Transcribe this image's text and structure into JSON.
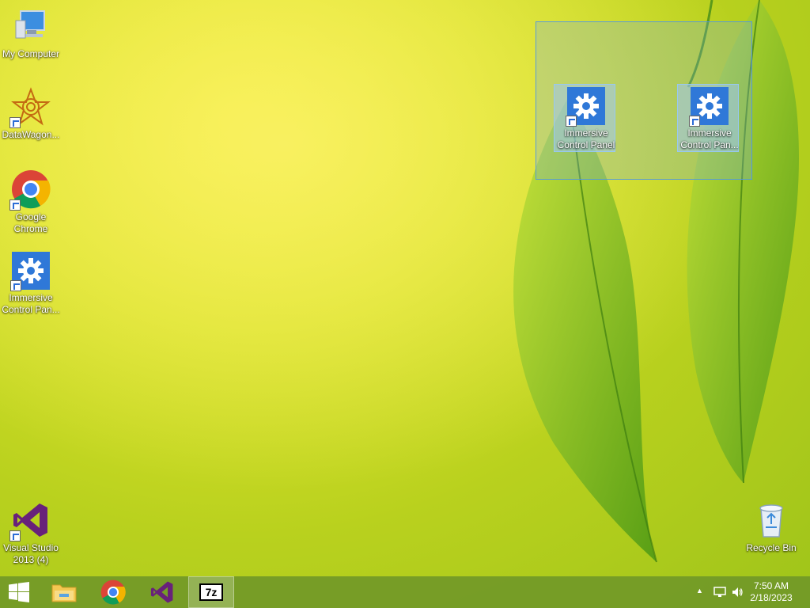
{
  "desktop": {
    "icons": [
      {
        "label": "My Computer"
      },
      {
        "label": "DataWagon..."
      },
      {
        "label": "Google Chrome"
      },
      {
        "label": "Immersive Control Pan..."
      },
      {
        "label": "Visual Studio 2013 (4)"
      },
      {
        "label": "Immersive Control Panel"
      },
      {
        "label": "Immersive Control Pan..."
      },
      {
        "label": "Recycle Bin"
      }
    ]
  },
  "taskbar": {
    "pinned": [
      "start-button",
      "file-explorer",
      "google-chrome",
      "visual-studio",
      "7zip"
    ],
    "sevenzip_label": "7z",
    "clock": {
      "time": "7:50 AM",
      "date": "2/18/2023"
    }
  },
  "colors": {
    "accent": "#2f78d8",
    "taskbar": "#6e9628"
  }
}
